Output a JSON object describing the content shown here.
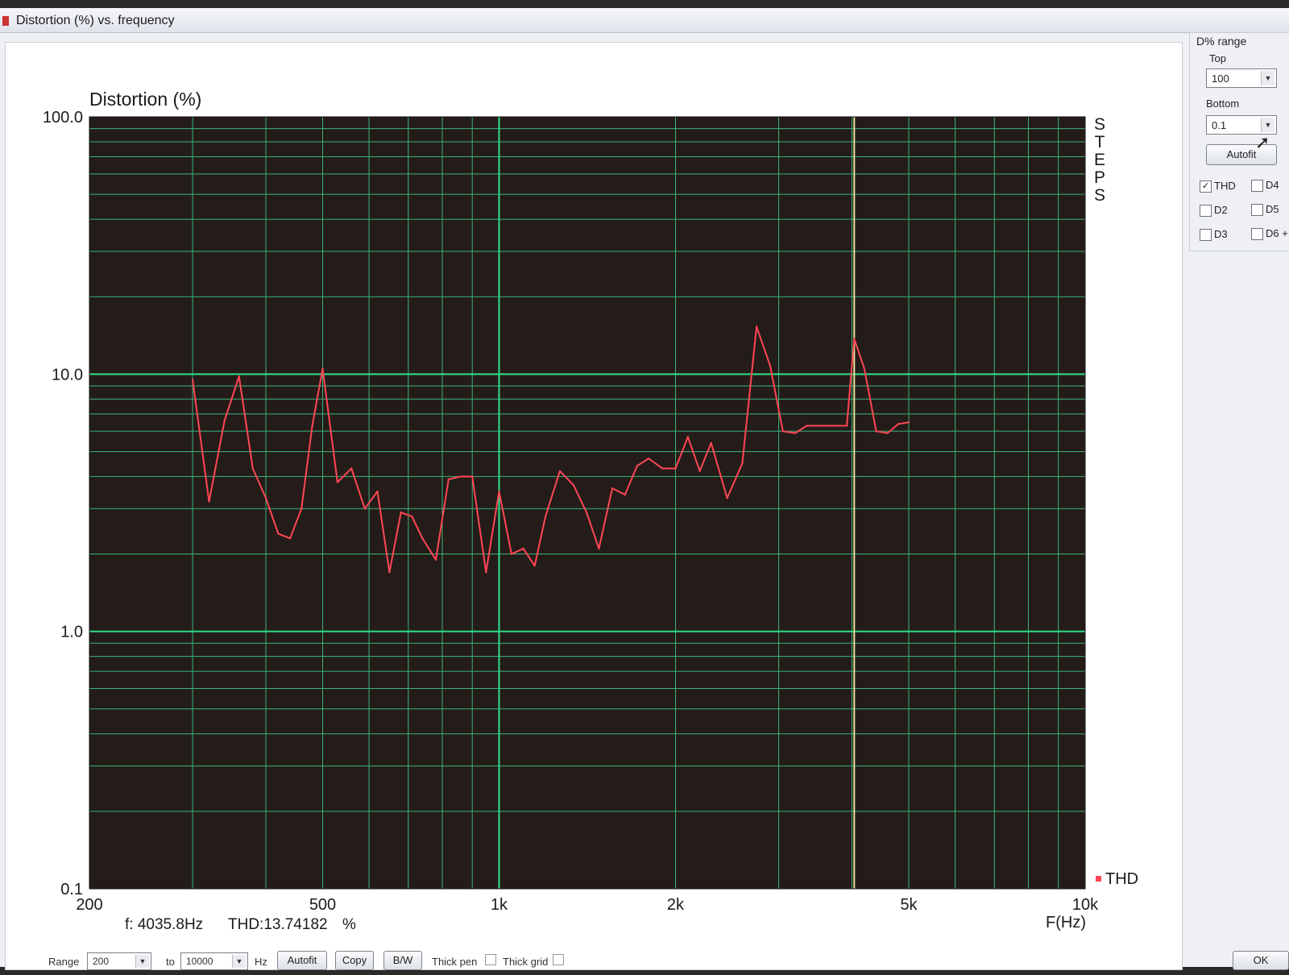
{
  "window": {
    "title": "Distortion (%) vs. frequency"
  },
  "panel": {
    "title": "D% range",
    "top_label": "Top",
    "top_value": "100",
    "bottom_label": "Bottom",
    "bottom_value": "0.1",
    "autofit_label": "Autofit",
    "checks": [
      {
        "label": "THD",
        "checked": true
      },
      {
        "label": "D4",
        "checked": false
      },
      {
        "label": "D2",
        "checked": false
      },
      {
        "label": "D5",
        "checked": false
      },
      {
        "label": "D3",
        "checked": false
      },
      {
        "label": "D6 +",
        "checked": false
      }
    ]
  },
  "readout": {
    "freq": "f: 4035.8Hz",
    "thd": "THD:13.74182",
    "unit": "%"
  },
  "side_label": [
    "S",
    "T",
    "E",
    "P",
    "S"
  ],
  "bottom": {
    "range_label": "Range",
    "range_from": "200",
    "to_label": "to",
    "range_to": "10000",
    "hz_label": "Hz",
    "autofit": "Autofit",
    "copy": "Copy",
    "bw": "B/W",
    "thick_pen": "Thick pen",
    "thick_grid": "Thick grid",
    "ok": "OK"
  },
  "colors": {
    "plot_bg": "#241c19",
    "major_grid": "#2ee08a",
    "minor_grid": "#3bb57a",
    "series": "#ff4655",
    "cursor": "#e8e39a"
  },
  "chart_data": {
    "type": "line",
    "title": "Distortion (%)",
    "xlabel": "F(Hz)",
    "ylabel": "Distortion (%)",
    "x_scale": "log",
    "y_scale": "log",
    "xlim": [
      200,
      10000
    ],
    "ylim": [
      0.1,
      100
    ],
    "x_ticks": [
      {
        "value": 200,
        "label": "200"
      },
      {
        "value": 500,
        "label": "500"
      },
      {
        "value": 1000,
        "label": "1k"
      },
      {
        "value": 2000,
        "label": "2k"
      },
      {
        "value": 5000,
        "label": "5k"
      },
      {
        "value": 10000,
        "label": "10k"
      }
    ],
    "y_ticks": [
      {
        "value": 100,
        "label": "100.0"
      },
      {
        "value": 10,
        "label": "10.0"
      },
      {
        "value": 1,
        "label": "1.0"
      },
      {
        "value": 0.1,
        "label": "0.1"
      }
    ],
    "grid": true,
    "legend": {
      "position": "bottom-right",
      "entries": [
        "THD"
      ]
    },
    "cursor_x": 4035.8,
    "series": [
      {
        "name": "THD",
        "x": [
          300,
          320,
          340,
          360,
          380,
          400,
          420,
          440,
          460,
          480,
          500,
          530,
          560,
          590,
          620,
          650,
          680,
          710,
          740,
          780,
          820,
          860,
          900,
          950,
          1000,
          1050,
          1100,
          1150,
          1200,
          1270,
          1340,
          1410,
          1480,
          1560,
          1640,
          1720,
          1800,
          1900,
          2000,
          2100,
          2200,
          2300,
          2450,
          2600,
          2750,
          2900,
          3050,
          3200,
          3350,
          3500,
          3650,
          3800,
          3920,
          4035.8,
          4200,
          4400,
          4600,
          4800,
          5000
        ],
        "y": [
          9.5,
          3.2,
          6.6,
          9.8,
          4.3,
          3.3,
          2.4,
          2.3,
          3.0,
          6.3,
          10.5,
          3.8,
          4.3,
          3.0,
          3.5,
          1.7,
          2.9,
          2.8,
          2.3,
          1.9,
          3.9,
          4.0,
          4.0,
          1.7,
          3.5,
          2.0,
          2.1,
          1.8,
          2.8,
          4.2,
          3.7,
          2.9,
          2.1,
          3.6,
          3.4,
          4.4,
          4.7,
          4.3,
          4.3,
          5.7,
          4.2,
          5.4,
          3.3,
          4.5,
          15.3,
          10.8,
          6.0,
          5.9,
          6.3,
          6.3,
          6.3,
          6.3,
          6.3,
          13.74,
          10.5,
          6.0,
          5.9,
          6.4,
          6.5
        ]
      }
    ]
  }
}
